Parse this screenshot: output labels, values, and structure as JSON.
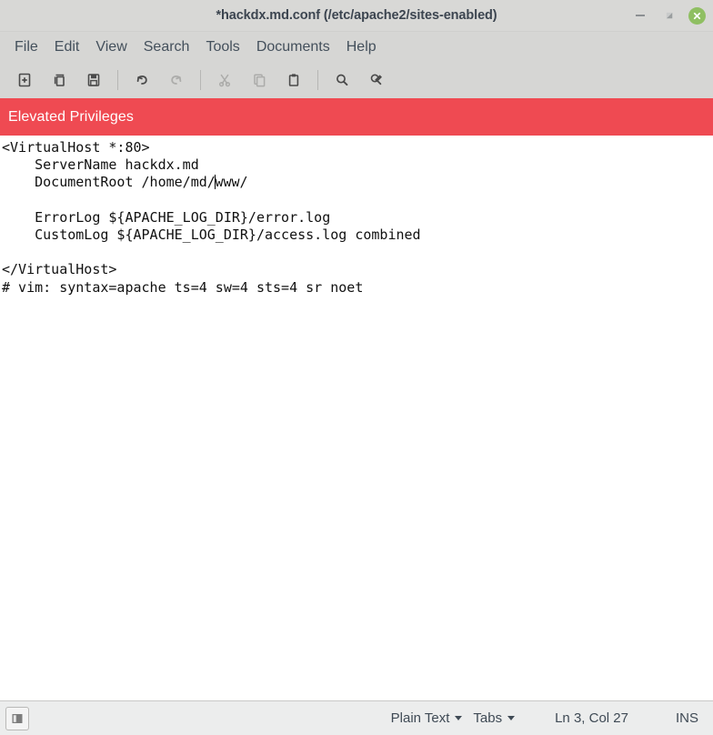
{
  "window": {
    "title": "*hackdx.md.conf (/etc/apache2/sites-enabled)",
    "controls": {
      "minimize_label": "Minimize",
      "maximize_label": "Restore",
      "close_label": "Close"
    }
  },
  "menubar": {
    "items": [
      {
        "label": "File",
        "name": "menu-file"
      },
      {
        "label": "Edit",
        "name": "menu-edit"
      },
      {
        "label": "View",
        "name": "menu-view"
      },
      {
        "label": "Search",
        "name": "menu-search"
      },
      {
        "label": "Tools",
        "name": "menu-tools"
      },
      {
        "label": "Documents",
        "name": "menu-documents"
      },
      {
        "label": "Help",
        "name": "menu-help"
      }
    ]
  },
  "toolbar": {
    "buttons": [
      {
        "name": "new-document-icon",
        "tooltip": "New"
      },
      {
        "name": "open-document-icon",
        "tooltip": "Open"
      },
      {
        "name": "save-icon",
        "tooltip": "Save"
      },
      {
        "name": "undo-icon",
        "tooltip": "Undo"
      },
      {
        "name": "redo-icon",
        "tooltip": "Redo"
      },
      {
        "name": "cut-icon",
        "tooltip": "Cut"
      },
      {
        "name": "copy-icon",
        "tooltip": "Copy"
      },
      {
        "name": "paste-icon",
        "tooltip": "Paste"
      },
      {
        "name": "search-icon",
        "tooltip": "Find"
      },
      {
        "name": "find-replace-icon",
        "tooltip": "Find and Replace"
      }
    ]
  },
  "banner": {
    "text": "Elevated Privileges",
    "background_color": "#ef4a52",
    "text_color": "#ffffff"
  },
  "editor": {
    "lines": [
      "<VirtualHost *:80>",
      "    ServerName hackdx.md",
      "    DocumentRoot /home/md/www/",
      "",
      "    ErrorLog ${APACHE_LOG_DIR}/error.log",
      "    CustomLog ${APACHE_LOG_DIR}/access.log combined",
      "",
      "</VirtualHost>",
      "# vim: syntax=apache ts=4 sw=4 sts=4 sr noet"
    ],
    "cursor_line_index": 2,
    "cursor_prefix": "    DocumentRoot /home/md/",
    "cursor_suffix": "www/"
  },
  "statusbar": {
    "panel_toggle_name": "side-panel-toggle",
    "language": "Plain Text",
    "indentation": "Tabs",
    "position": "Ln 3, Col 27",
    "insert_mode": "INS"
  }
}
